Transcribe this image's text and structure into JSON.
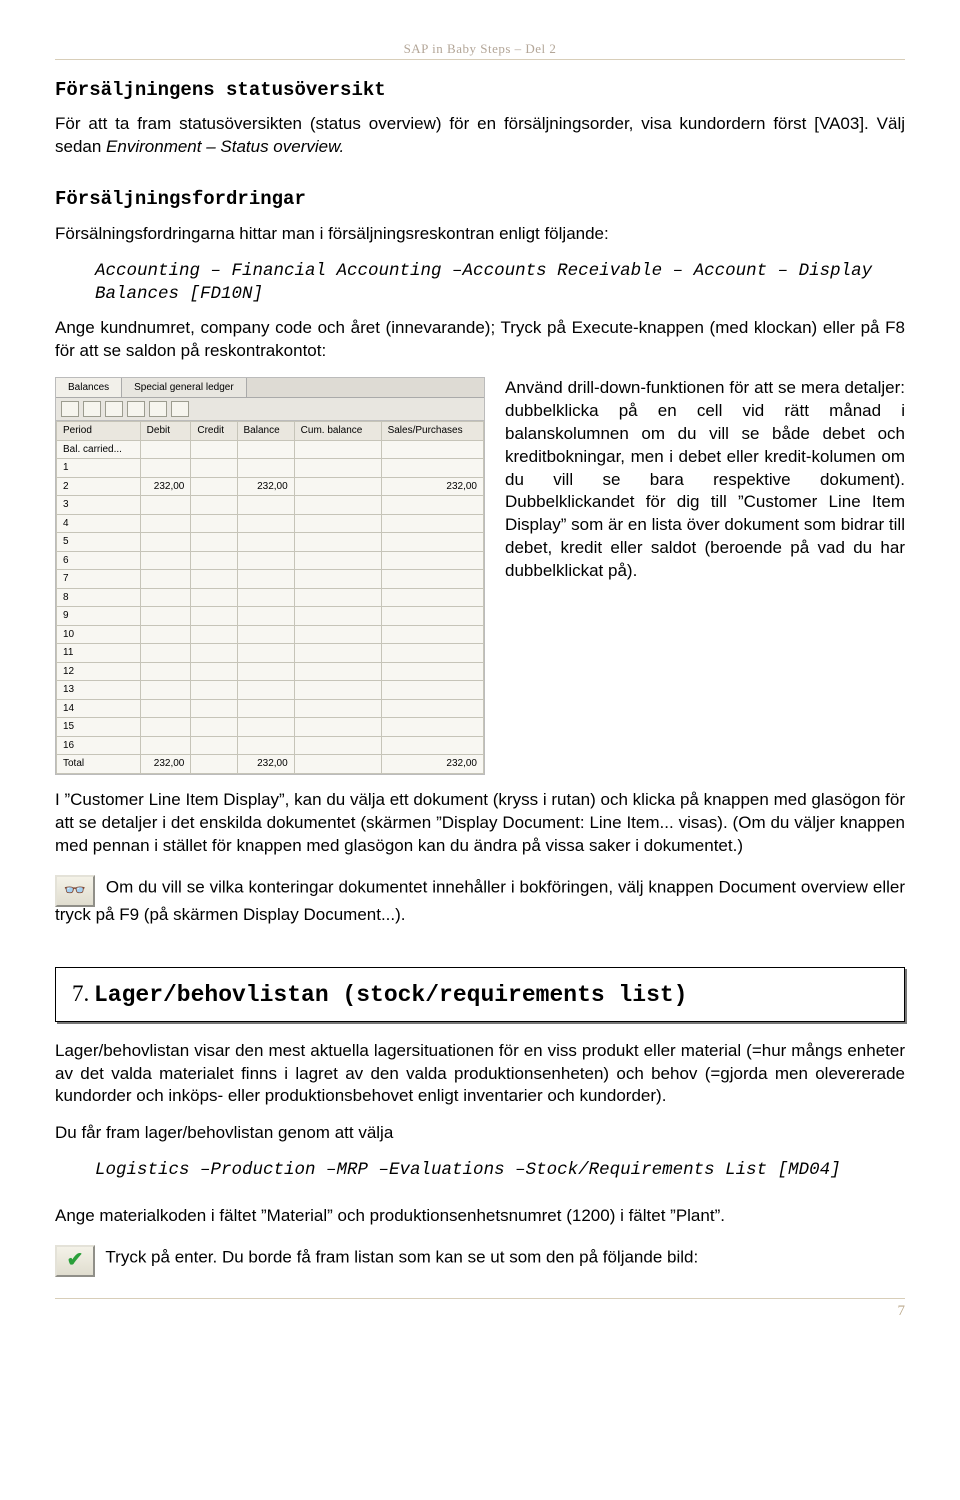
{
  "doc_header": "SAP in Baby Steps – Del 2",
  "sec1": {
    "title": "Försäljningens statusöversikt",
    "p1_a": "För att ta fram statusöversikten (status overview) för en försäljningsorder, visa kundordern först [VA03]. Välj sedan ",
    "p1_i": "Environment – Status overview.",
    "p2_title": "Försäljningsfordringar",
    "p3": "Försälningsfordringarna hittar man i försäljningsreskontran enligt följande:",
    "path": "Accounting – Financial Accounting –Accounts Receivable – Account – Display Balances [FD10N]",
    "p4": "Ange kundnumret, company code och året (innevarande); Tryck på Execute-knappen (med klockan) eller på F8 för att se saldon på reskontrakontot:"
  },
  "shot": {
    "tabs": [
      "Balances",
      "Special general ledger"
    ],
    "cols": [
      "Period",
      "Debit",
      "Credit",
      "Balance",
      "Cum. balance",
      "Sales/Purchases"
    ],
    "rows": [
      {
        "period": "Bal. carried...",
        "debit": "",
        "credit": "",
        "balance": "",
        "cum": "",
        "sales": ""
      },
      {
        "period": "1",
        "debit": "",
        "credit": "",
        "balance": "",
        "cum": "",
        "sales": ""
      },
      {
        "period": "2",
        "debit": "232,00",
        "credit": "",
        "balance": "232,00",
        "cum": "",
        "sales": "232,00"
      },
      {
        "period": "3",
        "debit": "",
        "credit": "",
        "balance": "",
        "cum": "",
        "sales": ""
      },
      {
        "period": "4",
        "debit": "",
        "credit": "",
        "balance": "",
        "cum": "",
        "sales": ""
      },
      {
        "period": "5",
        "debit": "",
        "credit": "",
        "balance": "",
        "cum": "",
        "sales": ""
      },
      {
        "period": "6",
        "debit": "",
        "credit": "",
        "balance": "",
        "cum": "",
        "sales": ""
      },
      {
        "period": "7",
        "debit": "",
        "credit": "",
        "balance": "",
        "cum": "",
        "sales": ""
      },
      {
        "period": "8",
        "debit": "",
        "credit": "",
        "balance": "",
        "cum": "",
        "sales": ""
      },
      {
        "period": "9",
        "debit": "",
        "credit": "",
        "balance": "",
        "cum": "",
        "sales": ""
      },
      {
        "period": "10",
        "debit": "",
        "credit": "",
        "balance": "",
        "cum": "",
        "sales": ""
      },
      {
        "period": "11",
        "debit": "",
        "credit": "",
        "balance": "",
        "cum": "",
        "sales": ""
      },
      {
        "period": "12",
        "debit": "",
        "credit": "",
        "balance": "",
        "cum": "",
        "sales": ""
      },
      {
        "period": "13",
        "debit": "",
        "credit": "",
        "balance": "",
        "cum": "",
        "sales": ""
      },
      {
        "period": "14",
        "debit": "",
        "credit": "",
        "balance": "",
        "cum": "",
        "sales": ""
      },
      {
        "period": "15",
        "debit": "",
        "credit": "",
        "balance": "",
        "cum": "",
        "sales": ""
      },
      {
        "period": "16",
        "debit": "",
        "credit": "",
        "balance": "",
        "cum": "",
        "sales": ""
      },
      {
        "period": "Total",
        "debit": "232,00",
        "credit": "",
        "balance": "232,00",
        "cum": "",
        "sales": "232,00"
      }
    ]
  },
  "rightpara": "Använd drill-down-funktionen för att se mera detaljer: dubbelklicka på en cell vid rätt månad i balanskolumnen om du vill se både debet och kreditbokningar, men i debet eller kredit-kolumen om du vill se bara respektive dokument). Dubbelklickandet för dig till ”Customer Line Item Display” som är en lista över dokument som bidrar till debet, kredit eller saldot (beroende på vad du har dubbelklickat på).",
  "p5": "I ”Customer Line Item Display”, kan du välja ett dokument (kryss i rutan) och klicka på knappen med glasögon för att se detaljer i det enskilda dokumentet (skärmen ”Display Document: Line Item... visas). (Om du väljer knappen med pennan i stället för knappen med glasögon kan du ändra på vissa saker i dokumentet.)",
  "p6": "Om du vill se vilka konteringar dokumentet innehåller i bokföringen, välj knappen Document overview eller tryck på F9  (på skärmen Display Document...).",
  "chapter": {
    "num": "7.",
    "title": "Lager/behovlistan (stock/requirements list)"
  },
  "p7": "Lager/behovlistan visar den mest aktuella lagersituationen för en viss produkt eller material (=hur mångs enheter av det valda materialet finns i lagret av den valda produktionsenheten) och behov (=gjorda men olevererade kundorder och inköps- eller produktionsbehovet enligt inventarier och kundorder).",
  "p8": "Du får fram lager/behovlistan genom att välja",
  "path2": "Logistics –Production –MRP –Evaluations –Stock/Requirements List [MD04]",
  "p9": "Ange materialkoden i fältet ”Material” och produktionsenhetsnumret (1200) i fältet ”Plant”.",
  "p10": "Tryck på enter. Du borde få fram listan som kan se ut som den på följande bild:",
  "page_num": "7"
}
